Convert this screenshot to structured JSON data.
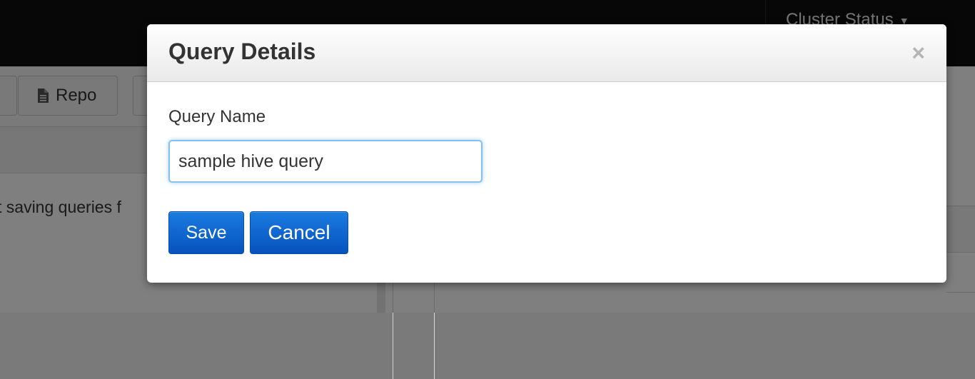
{
  "background": {
    "cluster_status_label": "Cluster Status",
    "repo_button_label": "Repo",
    "partial_text": "t saving queries f"
  },
  "modal": {
    "title": "Query Details",
    "close_symbol": "×",
    "query_name_label": "Query Name",
    "query_name_value": "sample hive query",
    "save_label": "Save",
    "cancel_label": "Cancel"
  },
  "colors": {
    "primary_button": "#0752bd",
    "input_focus": "#86c0ec",
    "topbar": "#0e0e0e"
  }
}
